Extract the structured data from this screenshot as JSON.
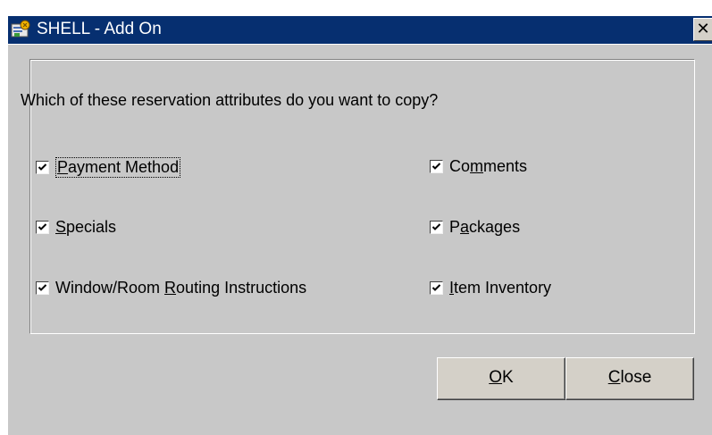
{
  "window": {
    "title": "SHELL - Add On",
    "icon": "app-icon",
    "close_glyph": "✕"
  },
  "dialog": {
    "question": "Which of these reservation attributes do you want to copy?",
    "options_left": [
      {
        "pre": "",
        "mnemonic": "P",
        "post": "ayment Method",
        "checked": true,
        "focused": true
      },
      {
        "pre": "",
        "mnemonic": "S",
        "post": "pecials",
        "checked": true,
        "focused": false
      },
      {
        "pre": "Window/Room ",
        "mnemonic": "R",
        "post": "outing Instructions",
        "checked": true,
        "focused": false
      }
    ],
    "options_right": [
      {
        "pre": "Co",
        "mnemonic": "m",
        "post": "ments",
        "checked": true,
        "focused": false
      },
      {
        "pre": "P",
        "mnemonic": "a",
        "post": "ckages",
        "checked": true,
        "focused": false
      },
      {
        "pre": "",
        "mnemonic": "I",
        "post": "tem Inventory",
        "checked": true,
        "focused": false
      }
    ]
  },
  "buttons": {
    "ok": {
      "mnemonic": "O",
      "post": "K"
    },
    "close": {
      "mnemonic": "C",
      "post": "lose"
    }
  },
  "colors": {
    "titlebar": "#062f70",
    "dialog_bg": "#c8c8c8"
  }
}
